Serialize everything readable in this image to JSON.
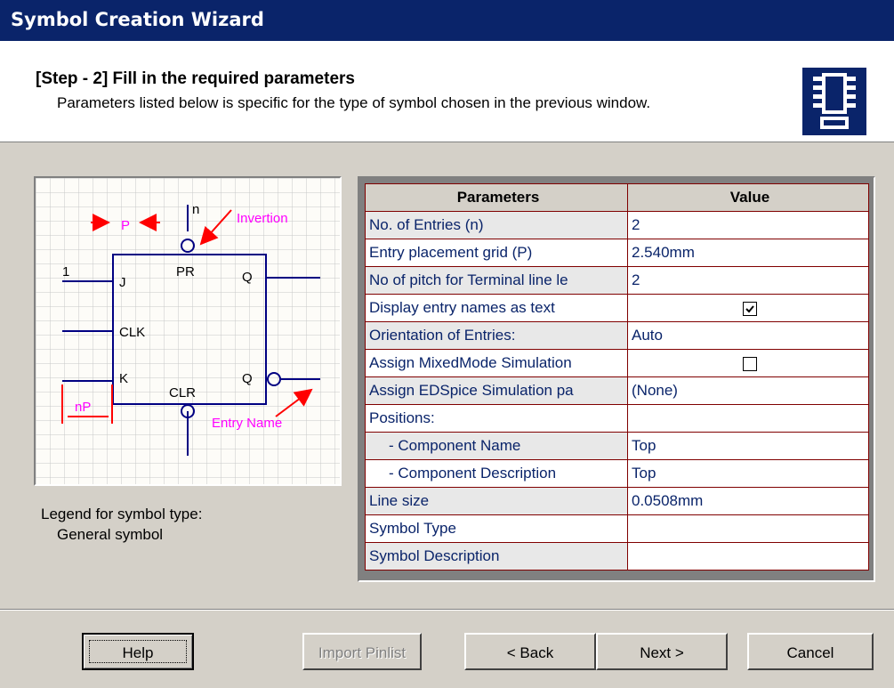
{
  "window": {
    "title": "Symbol Creation Wizard"
  },
  "header": {
    "step": "[Step - 2] Fill in the required parameters",
    "description": "Parameters listed below is specific for the type of symbol chosen in the previous window."
  },
  "diagram": {
    "labels": {
      "n": "n",
      "p": "P",
      "invertion": "Invertion",
      "one": "1",
      "j": "J",
      "pr": "PR",
      "q1": "Q",
      "clk": "CLK",
      "k": "K",
      "clr": "CLR",
      "q2": "Q",
      "np": "nP",
      "entry_name": "Entry Name"
    }
  },
  "legend": {
    "label": "Legend for symbol type:",
    "value": "General symbol"
  },
  "table": {
    "headers": [
      "Parameters",
      "Value"
    ],
    "rows": [
      {
        "param": "No. of Entries (n)",
        "value": "2"
      },
      {
        "param": "Entry placement grid (P)",
        "value": "2.540mm"
      },
      {
        "param": "No of pitch for Terminal line le",
        "value": "2"
      },
      {
        "param": "Display entry names as text",
        "checked": true
      },
      {
        "param": "Orientation of Entries:",
        "value": "Auto"
      },
      {
        "param": "Assign MixedMode Simulation",
        "checked": false
      },
      {
        "param": "Assign EDSpice Simulation pa",
        "value": "(None)"
      },
      {
        "param": "Positions:",
        "value": ""
      },
      {
        "param": "- Component Name",
        "value": "Top"
      },
      {
        "param": "- Component Description",
        "value": "Top"
      },
      {
        "param": "Line size",
        "value": "0.0508mm"
      },
      {
        "param": "Symbol Type",
        "value": ""
      },
      {
        "param": "Symbol Description",
        "value": ""
      }
    ]
  },
  "buttons": {
    "help": "Help",
    "import_pinlist": "Import Pinlist",
    "back": "< Back",
    "next": "Next >",
    "cancel": "Cancel"
  },
  "colors": {
    "titlebar": "#0a246a",
    "dialog": "#d4d0c8",
    "table_text": "#0a246a",
    "table_border": "#800000",
    "diagram_label": "#ff00ff"
  }
}
